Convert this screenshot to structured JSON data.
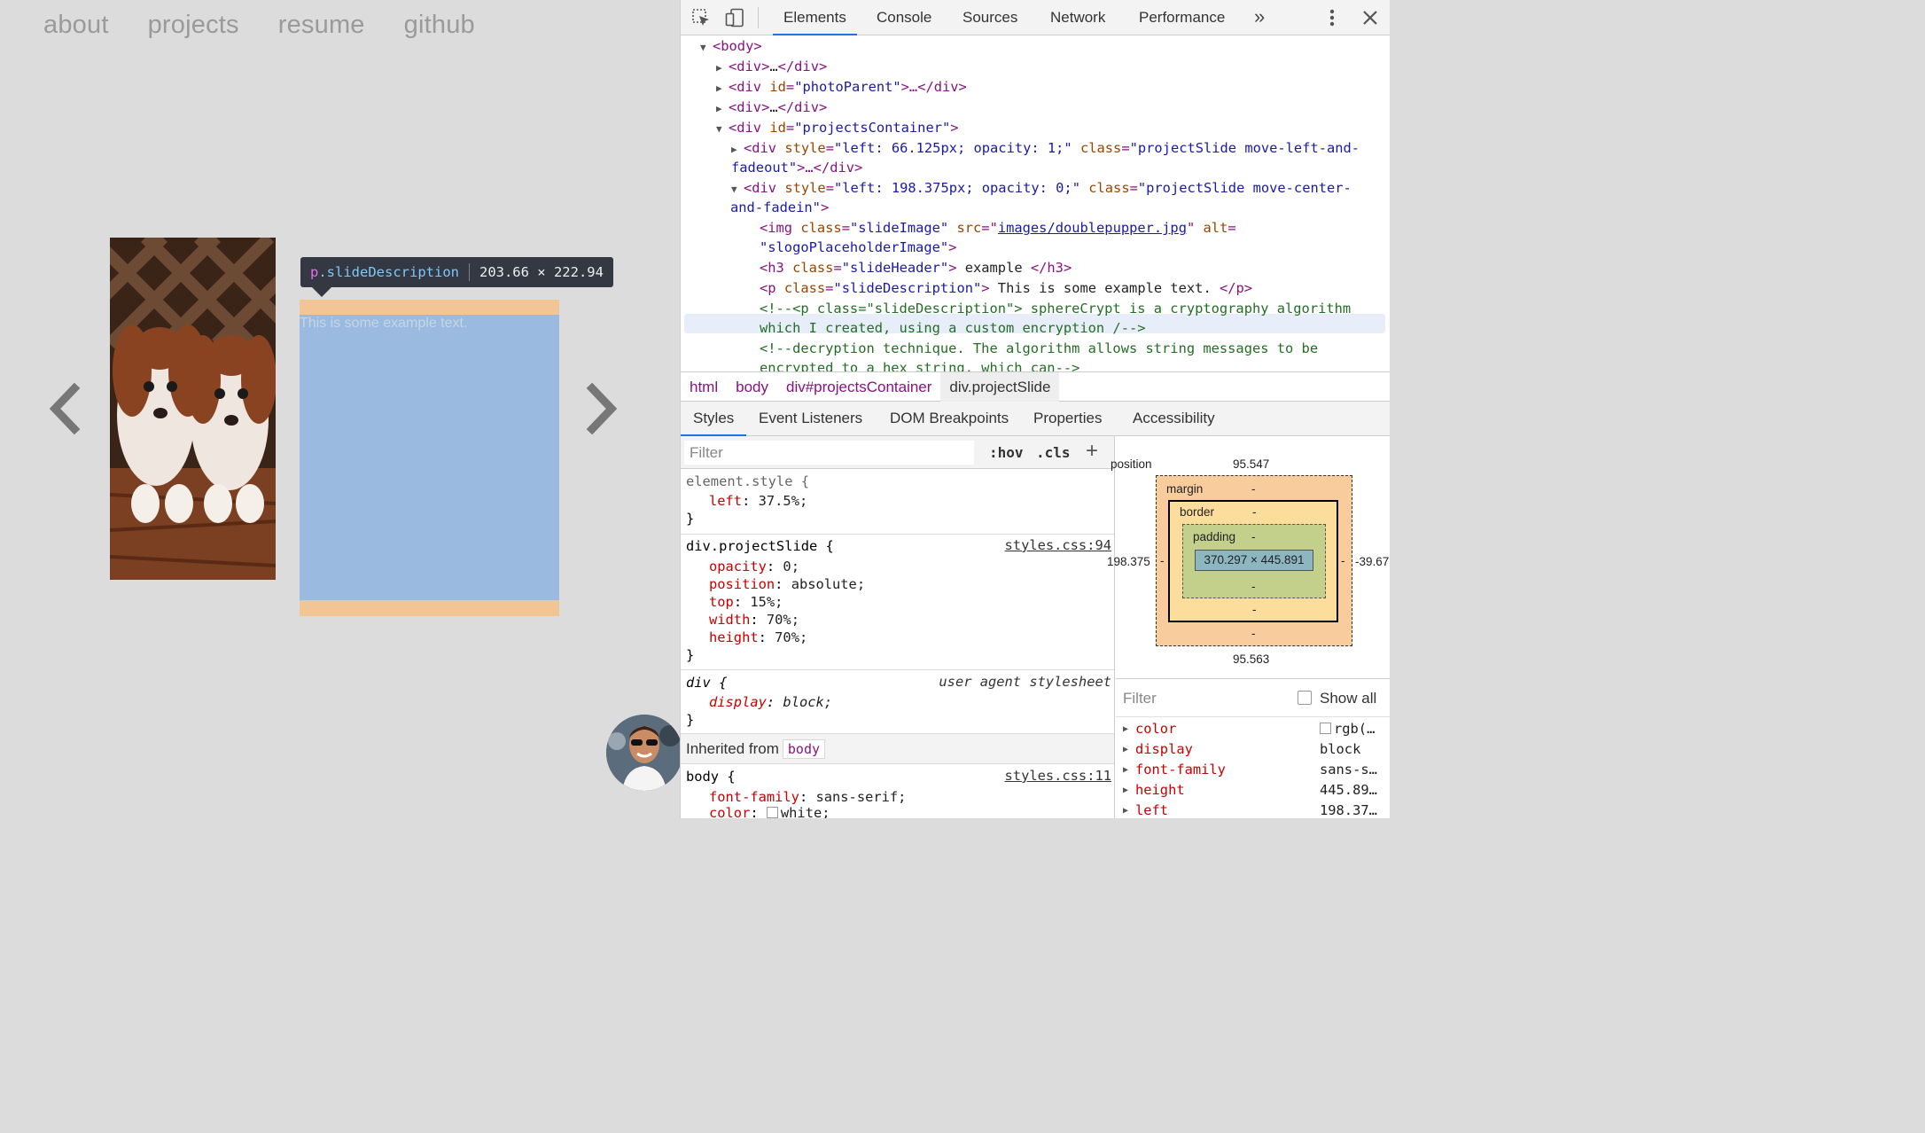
{
  "page": {
    "nav": [
      "about",
      "projects",
      "resume",
      "github"
    ],
    "highlight_text": "This is some example text.",
    "tooltip": {
      "tag": "p",
      "class": ".slideDescription",
      "size": "203.66 × 222.94"
    }
  },
  "devtools": {
    "tabs": [
      "Elements",
      "Console",
      "Sources",
      "Network",
      "Performance"
    ],
    "more_tabs": "»",
    "active_tab": "Elements",
    "dom": {
      "body": "<body>",
      "div1_open": "<div>",
      "div1_ellipsis": "…",
      "div1_close": "</div>",
      "div2_tag": "<div",
      "div2_attr": "id",
      "div2_val": "\"photoParent\"",
      "div2_rest": ">…</div>",
      "div3_open": "<div>",
      "div3_ellipsis": "…",
      "div3_close": "</div>",
      "pc_tag": "<div",
      "pc_attr": "id",
      "pc_val": "\"projectsContainer\"",
      "pc_rest": ">",
      "s1_tag": "<div",
      "s1_attr1": "style",
      "s1_val1": "\"left: 66.125px; opacity: 1;\"",
      "s1_attr2": "class",
      "s1_val2a": "\"projectSlide move-left-and-",
      "s1_val2b": "fadeout\"",
      "s1_rest": ">…</div>",
      "s2_tag": "<div",
      "s2_attr1": "style",
      "s2_val1": "\"left: 198.375px; opacity: 0;\"",
      "s2_attr2": "class",
      "s2_val2a": "\"projectSlide move-center-",
      "s2_val2b": "and-fadein\"",
      "s2_rest": ">",
      "img_tag": "<img",
      "img_attr1": "class",
      "img_val1": "\"slideImage\"",
      "img_attr2": "src",
      "img_link": "images/doublepupper.jpg",
      "img_attr3": "alt",
      "img_val3": "\"slogoPlaceholderImage\"",
      "img_end": ">",
      "h3_tag": "<h3",
      "h3_attr": "class",
      "h3_val": "\"slideHeader\"",
      "h3_text": " example ",
      "h3_close": "</h3>",
      "p_tag": "<p",
      "p_attr": "class",
      "p_val": "\"slideDescription\"",
      "p_text": " This is some example text. ",
      "p_close": "</p>",
      "c1a": "<!--<p class=\"slideDescription\"> sphereCrypt is a cryptography algorithm",
      "c1b": "which I created, using a custom encryption /-->",
      "c2a": "<!--decryption technique. The algorithm allows string messages to be",
      "c2b": "encrypted to a hex string, which can-->"
    },
    "breadcrumbs": [
      "html",
      "body",
      "div#projectsContainer",
      "div.projectSlide"
    ],
    "subtabs": [
      "Styles",
      "Event Listeners",
      "DOM Breakpoints",
      "Properties",
      "Accessibility"
    ],
    "styles": {
      "filter_placeholder": "Filter",
      "hov": ":hov",
      "cls": ".cls",
      "plus": "+",
      "element_style": "element.style {",
      "es_prop": "left",
      "es_val": " 37.5%;",
      "close_brace": "}",
      "ps_selector": "div.projectSlide {",
      "ps_source": "styles.css:94",
      "ps_props": [
        {
          "name": "opacity",
          "value": " 0;"
        },
        {
          "name": "position",
          "value": " absolute;"
        },
        {
          "name": "top",
          "value": " 15%;"
        },
        {
          "name": "width",
          "value": " 70%;"
        },
        {
          "name": "height",
          "value": " 70%;"
        }
      ],
      "ua_selector": "div {",
      "ua_source": "user agent stylesheet",
      "ua_prop": "display",
      "ua_val": " block;",
      "inherited_label": "Inherited from",
      "inherited_el": "body",
      "body_selector": "body {",
      "body_source": "styles.css:11",
      "body_prop1": "font-family",
      "body_val1": " sans-serif;",
      "body_prop2": "color",
      "body_val2": "white;"
    },
    "boxmodel": {
      "position_label": "position",
      "pos_top": "95.547",
      "pos_bottom": "95.563",
      "pos_left": "198.375",
      "pos_right": "-39.67",
      "margin_label": "margin",
      "margin_val": "-",
      "border_label": "border",
      "border_val": "-",
      "padding_label": "padding",
      "padding_val": "-",
      "content_size": "370.297 × 445.891",
      "dash": "-"
    },
    "computed": {
      "filter_placeholder": "Filter",
      "show_all": "Show all",
      "rows": [
        {
          "name": "color",
          "value": "rgb(…"
        },
        {
          "name": "display",
          "value": "block"
        },
        {
          "name": "font-family",
          "value": "sans-s…"
        },
        {
          "name": "height",
          "value": "445.89…"
        },
        {
          "name": "left",
          "value": "198.37…"
        }
      ]
    }
  }
}
